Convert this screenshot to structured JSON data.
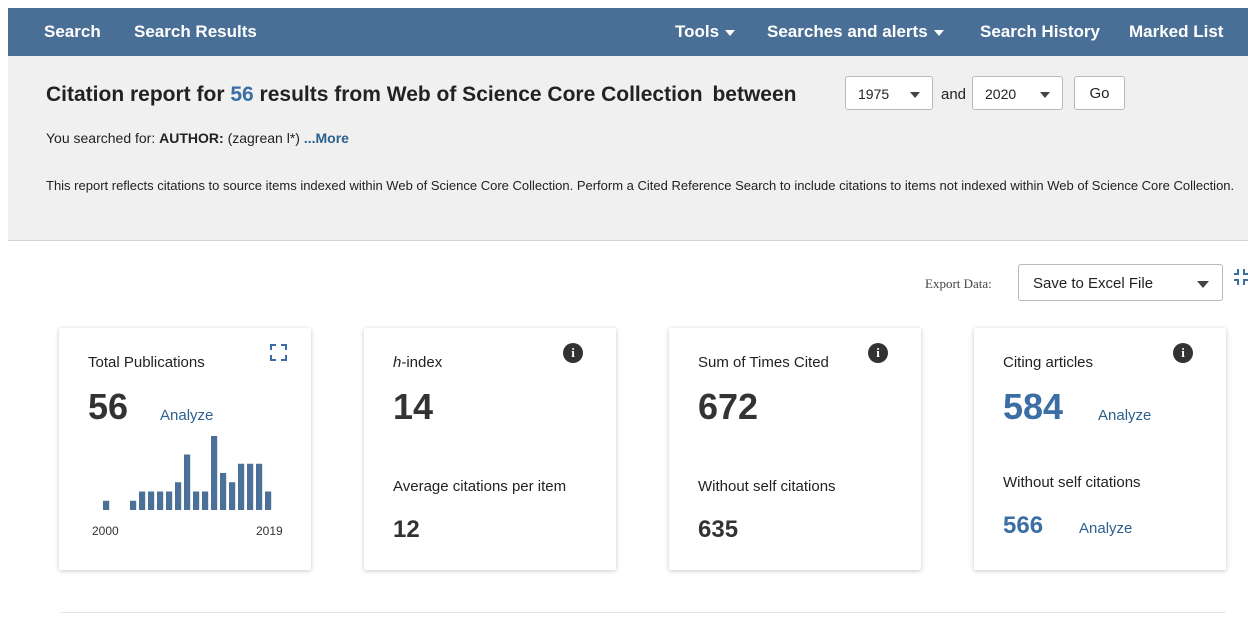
{
  "nav": {
    "search": "Search",
    "search_results": "Search Results",
    "tools": "Tools",
    "searches_alerts": "Searches and alerts",
    "search_history": "Search History",
    "marked_list": "Marked List"
  },
  "report": {
    "prefix": "Citation report for",
    "count": "56",
    "suffix": "results from Web of Science Core Collection",
    "between": "between",
    "year_from": "1975",
    "and": "and",
    "year_to": "2020",
    "go": "Go",
    "searched_label": "You searched for:",
    "searched_field": "AUTHOR:",
    "searched_query": "(zagrean l*)",
    "more": "...More",
    "disclaimer": "This report reflects citations to source items indexed within Web of Science Core Collection. Perform a Cited Reference Search to include citations to items not indexed within Web of Science Core Collection."
  },
  "export": {
    "label": "Export Data:",
    "option": "Save to Excel File"
  },
  "cards": {
    "total": {
      "label": "Total Publications",
      "value": "56",
      "analyze": "Analyze",
      "start_year": "2000",
      "end_year": "2019"
    },
    "hindex": {
      "label_italic": "h",
      "label": "-index",
      "value": "14",
      "sub_label": "Average citations per item",
      "sub_value": "12"
    },
    "times_cited": {
      "label": "Sum of Times Cited",
      "value": "672",
      "sub_label": "Without self citations",
      "sub_value": "635"
    },
    "citing": {
      "label": "Citing articles",
      "value": "584",
      "analyze": "Analyze",
      "sub_label": "Without self citations",
      "sub_value": "566",
      "sub_analyze": "Analyze"
    }
  },
  "chart_data": {
    "type": "bar",
    "categories": [
      "2000",
      "2001",
      "2002",
      "2003",
      "2004",
      "2005",
      "2006",
      "2007",
      "2008",
      "2009",
      "2010",
      "2011",
      "2012",
      "2013",
      "2014",
      "2015",
      "2016",
      "2017",
      "2018",
      "2019"
    ],
    "values": [
      1,
      0,
      0,
      1,
      2,
      2,
      2,
      2,
      3,
      6,
      2,
      2,
      8,
      4,
      3,
      5,
      5,
      5,
      2,
      0
    ],
    "xlabel": "",
    "ylabel": "",
    "colors": {
      "bar": "#4b7199"
    }
  },
  "colors": {
    "topbar": "#4a6f96",
    "accent": "#3a6ea5",
    "link": "#2d5f8f",
    "band": "#f0f0f0"
  }
}
